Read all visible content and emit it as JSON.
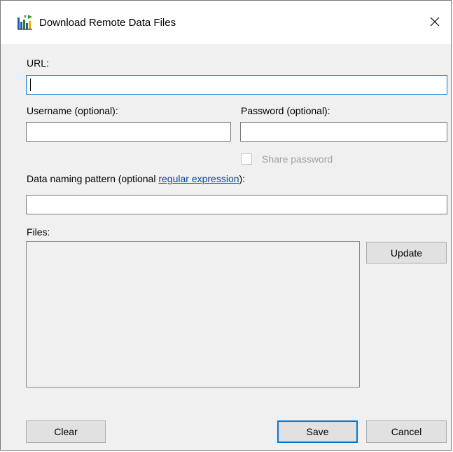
{
  "window": {
    "title": "Download Remote Data Files",
    "icon": "app-chart-icon",
    "close_glyph": "✕"
  },
  "form": {
    "url_label": "URL:",
    "url_value": "",
    "username_label": "Username (optional):",
    "username_value": "",
    "password_label": "Password (optional):",
    "password_value": "",
    "share_password_label": "Share password",
    "share_password_checked": false,
    "naming_pattern_label_prefix": "Data naming pattern (optional ",
    "naming_pattern_link": "regular expression",
    "naming_pattern_label_suffix": "):",
    "naming_pattern_value": "",
    "files_label": "Files:",
    "files": []
  },
  "buttons": {
    "update": "Update",
    "clear": "Clear",
    "save": "Save",
    "cancel": "Cancel"
  },
  "colors": {
    "focus_accent": "#0078d7",
    "link": "#0645ad",
    "disabled_text": "#a0a0a0",
    "dialog_bg": "#f0f0f0"
  }
}
